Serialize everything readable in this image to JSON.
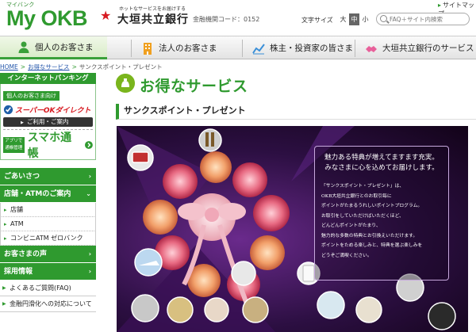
{
  "header": {
    "brand_kana": "マイバンク",
    "brand_name": "My OKB",
    "bank_tagline": "ホットなサービスをお届けする",
    "bank_name": "大垣共立銀行",
    "bank_code": "金融機関コード：0152",
    "sitemap_label": "サイトマップ",
    "font_size_label": "文字サイズ",
    "font_sizes": [
      "大",
      "中",
      "小"
    ],
    "font_size_selected": "中",
    "search_placeholder": "FAQ＋サイト内検索"
  },
  "nav": {
    "items": [
      {
        "label": "個人のお客さま",
        "icon": "person-icon",
        "active": true
      },
      {
        "label": "法人のお客さま",
        "icon": "building-icon",
        "active": false
      },
      {
        "label": "株主・投資家の皆さま",
        "icon": "chart-icon",
        "active": false
      },
      {
        "label": "大垣共立銀行のサービス",
        "icon": "handshake-icon",
        "active": false
      }
    ]
  },
  "breadcrumb": {
    "home": "HOME",
    "parent": "お得なサービス",
    "current": "サンクスポイント・プレゼント"
  },
  "sidebar": {
    "ib_title": "インターネットバンキング",
    "ib_subtitle": "個人のお客さま向け",
    "sokd_name": "スーパーOKダイレクト",
    "sokd_link": "ご利用・ご案内",
    "app_badge": "アプリで\n通帳管理",
    "sumaho_name": "スマホ通帳",
    "menu": [
      {
        "label": "ごあいさつ",
        "type": "head"
      },
      {
        "label": "店舗・ATMのご案内",
        "type": "head-open"
      },
      {
        "label": "店舗",
        "type": "sub"
      },
      {
        "label": "ATM",
        "type": "sub"
      },
      {
        "label": "コンビニATM ゼロバンク",
        "type": "sub"
      },
      {
        "label": "お客さまの声",
        "type": "head"
      },
      {
        "label": "採用情報",
        "type": "head"
      },
      {
        "label": "よくあるご質問(FAQ)",
        "type": "plain"
      },
      {
        "label": "金融円滑化への対応について",
        "type": "plain"
      }
    ]
  },
  "main": {
    "page_title": "お得なサービス",
    "section_title": "サンクスポイント・プレゼント",
    "promo_head_1": "魅力ある特典が増えてますます充実。",
    "promo_head_2": "みなさまに心を込めてお届けします。",
    "promo_lines": [
      "「サンクスポイント・プレゼント」は、",
      "OKB大垣共立銀行とのお取引毎に",
      "ポイントがたまるうれしいポイントプログラム。",
      "お取引をしていただけばいただくほど、",
      "どんどんポイントがたまり、",
      "魅力的な多数の特典とお引換えいただけます。",
      "ポイントをためる楽しみと、特典を選ぶ楽しみを",
      "どうぞご満喫ください。"
    ]
  },
  "colors": {
    "brand_green": "#2f9a2f",
    "bank_red": "#d71920",
    "banner_purple": "#6a2a8c"
  }
}
